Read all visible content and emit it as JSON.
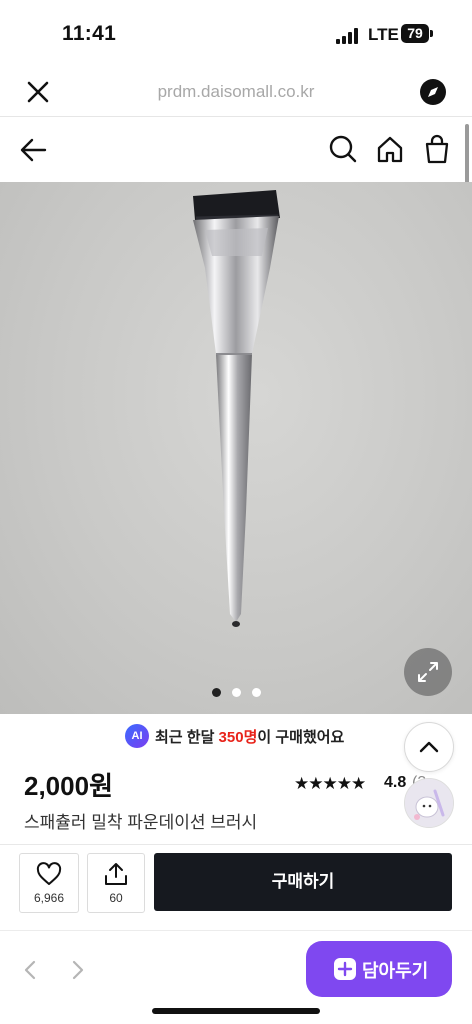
{
  "status_bar": {
    "time": "11:41",
    "network": "LTE",
    "battery": "79"
  },
  "browser": {
    "url": "prdm.daisomall.co.kr"
  },
  "gallery": {
    "slide_count": 3,
    "active_slide": 1
  },
  "purchase_info": {
    "ai_badge": "AI",
    "recent_prefix": "최근 한달 ",
    "recent_count": "350명",
    "recent_suffix": "이 구매했어요"
  },
  "product": {
    "price": "2,000원",
    "rating_stars": "★★★★★",
    "rating": "4.8",
    "review_count": "(3",
    "name": "스패츌러 밀착 파운데이션 브러시"
  },
  "actions": {
    "likes": "6,966",
    "shares": "60",
    "buy_label": "구매하기"
  },
  "bottom_bar": {
    "cart_label": "담아두기"
  },
  "colors": {
    "buy": "#16191f",
    "cart": "#7f48f0",
    "highlight": "#e8231a"
  }
}
